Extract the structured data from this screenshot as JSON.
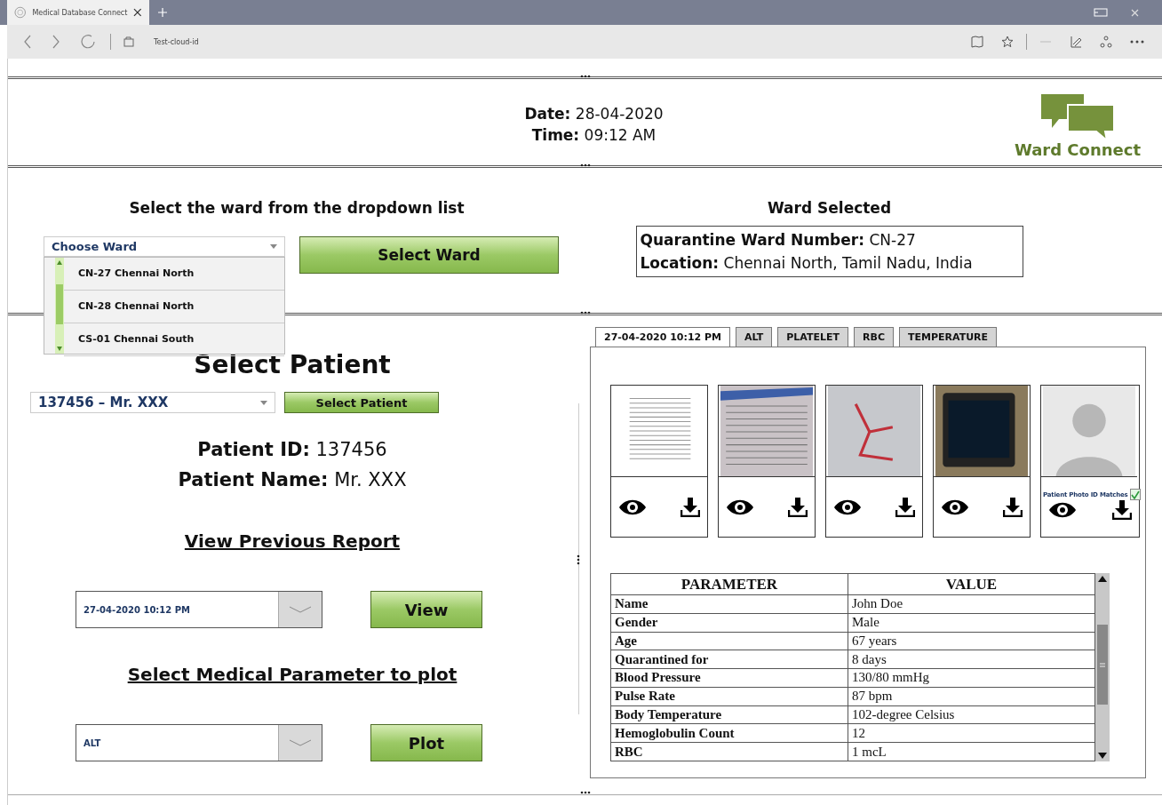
{
  "browser": {
    "tab_title": "Medical Database Connect",
    "address": "Test-cloud-id"
  },
  "header": {
    "date_label": "Date:",
    "date": "28-04-2020",
    "time_label": "Time:",
    "time": "09:12 AM",
    "logo_text": "Ward Connect"
  },
  "ward": {
    "heading": "Select the ward from the dropdown list",
    "combo_value": "Choose Ward",
    "options": [
      "CN-27 Chennai North",
      "CN-28 Chennai North",
      "CS-01 Chennai South"
    ],
    "button": "Select Ward",
    "selected_heading": "Ward Selected",
    "info": [
      {
        "label": "Quarantine Ward Number:",
        "value": "CN-27"
      },
      {
        "label": "Location:",
        "value": "Chennai North, Tamil Nadu, India"
      }
    ]
  },
  "patient": {
    "heading": "Select Patient",
    "combo_value": "137456 – Mr. XXX",
    "button": "Select Patient",
    "info": [
      {
        "label": "Patient ID:",
        "value": "137456"
      },
      {
        "label": "Patient Name:",
        "value": "Mr. XXX"
      }
    ],
    "report_heading": "View Previous Report",
    "report_value": "27-04-2020 10:12 PM",
    "report_button": "View",
    "plot_heading": "Select Medical Parameter to plot",
    "plot_value": "ALT",
    "plot_button": "Plot"
  },
  "report": {
    "tabs": [
      {
        "label": "27-04-2020 10:12 PM",
        "selected": true
      },
      {
        "label": "ALT",
        "selected": false
      },
      {
        "label": "PLATELET",
        "selected": false
      },
      {
        "label": "RBC",
        "selected": false
      },
      {
        "label": "TEMPERATURE",
        "selected": false
      }
    ],
    "cards": [
      {
        "kind": "document"
      },
      {
        "kind": "paper"
      },
      {
        "kind": "sample"
      },
      {
        "kind": "monitor"
      },
      {
        "kind": "person",
        "match_label": "Patient Photo ID Matches",
        "checked": true
      }
    ],
    "table": {
      "columns": [
        "PARAMETER",
        "VALUE"
      ],
      "rows": [
        [
          "Name",
          "John Doe"
        ],
        [
          "Gender",
          "Male"
        ],
        [
          "Age",
          "67 years"
        ],
        [
          "Quarantined for",
          "8 days"
        ],
        [
          "Blood Pressure",
          "130/80 mmHg"
        ],
        [
          "Pulse Rate",
          "87 bpm"
        ],
        [
          "Body Temperature",
          "102-degree Celsius"
        ],
        [
          "Hemoglobulin Count",
          "12"
        ],
        [
          "RBC",
          "1 mcL"
        ]
      ]
    }
  }
}
